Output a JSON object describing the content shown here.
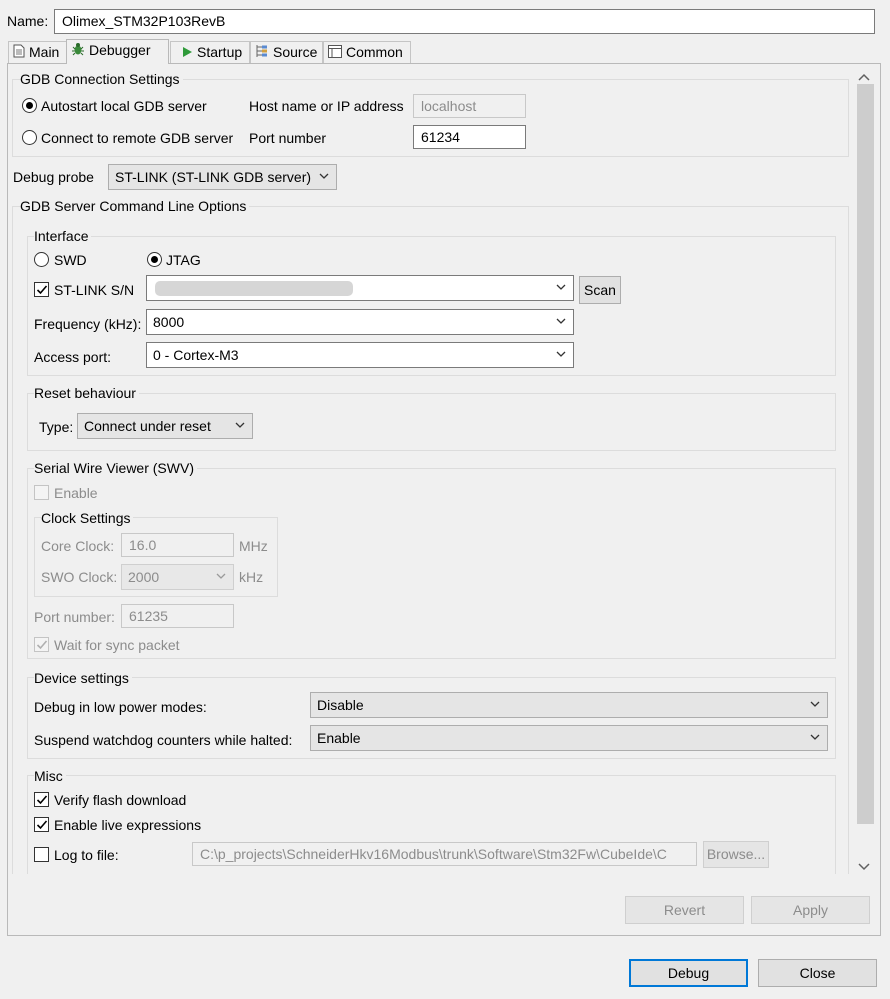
{
  "name_label": "Name:",
  "name_value": "Olimex_STM32P103RevB",
  "tabs": [
    {
      "label": "Main",
      "icon": "document-icon"
    },
    {
      "label": "Debugger",
      "icon": "bug-icon"
    },
    {
      "label": "Startup",
      "icon": "play-icon"
    },
    {
      "label": "Source",
      "icon": "source-icon"
    },
    {
      "label": "Common",
      "icon": "window-icon"
    }
  ],
  "gdb_connection": {
    "title": "GDB Connection Settings",
    "autostart_label": "Autostart local GDB server",
    "remote_label": "Connect to remote GDB server",
    "host_label": "Host name or IP address",
    "host_value": "localhost",
    "port_label": "Port number",
    "port_value": "61234"
  },
  "debug_probe": {
    "label": "Debug probe",
    "value": "ST-LINK (ST-LINK GDB server)"
  },
  "server_options": {
    "title": "GDB Server Command Line Options"
  },
  "interface": {
    "title": "Interface",
    "swd_label": "SWD",
    "jtag_label": "JTAG",
    "stlink_sn_label": "ST-LINK S/N",
    "scan_label": "Scan",
    "frequency_label": "Frequency (kHz):",
    "frequency_value": "8000",
    "access_port_label": "Access port:",
    "access_port_value": "0 - Cortex-M3"
  },
  "reset": {
    "title": "Reset behaviour",
    "type_label": "Type:",
    "type_value": "Connect under reset"
  },
  "swv": {
    "title": "Serial Wire Viewer (SWV)",
    "enable_label": "Enable",
    "clock_title": "Clock Settings",
    "core_clock_label": "Core Clock:",
    "core_clock_value": "16.0",
    "core_clock_unit": "MHz",
    "swo_clock_label": "SWO Clock:",
    "swo_clock_value": "2000",
    "swo_clock_unit": "kHz",
    "port_label": "Port number:",
    "port_value": "61235",
    "wait_sync_label": "Wait for sync packet"
  },
  "device": {
    "title": "Device settings",
    "low_power_label": "Debug in low power modes:",
    "low_power_value": "Disable",
    "watchdog_label": "Suspend watchdog counters while halted:",
    "watchdog_value": "Enable"
  },
  "misc": {
    "title": "Misc",
    "verify_label": "Verify flash download",
    "live_expr_label": "Enable live expressions",
    "log_label": "Log to file:",
    "log_path": "C:\\p_projects\\SchneiderHkv16Modbus\\trunk\\Software\\Stm32Fw\\CubeIde\\C",
    "browse_label": "Browse..."
  },
  "buttons": {
    "revert": "Revert",
    "apply": "Apply",
    "debug": "Debug",
    "close": "Close"
  }
}
